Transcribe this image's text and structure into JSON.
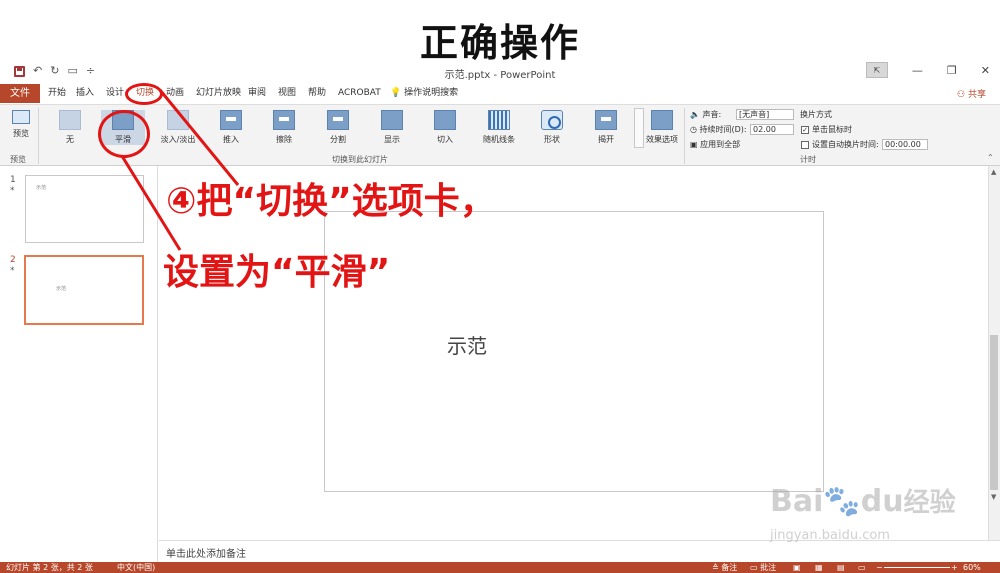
{
  "heading": "正确操作",
  "window": {
    "doc_title": "示范.pptx - PowerPoint",
    "share": "共享",
    "undo_icon": "↶",
    "redo_icon": "↻",
    "qat_more": "÷"
  },
  "tabs": {
    "file": "文件",
    "items": [
      "开始",
      "插入",
      "设计",
      "切换",
      "动画",
      "幻灯片放映",
      "审阅",
      "视图",
      "帮助",
      "ACROBAT",
      "操作说明搜索"
    ]
  },
  "ribbon": {
    "preview_label": "预览",
    "preview_group": "预览",
    "effects": [
      "无",
      "平滑",
      "淡入/淡出",
      "推入",
      "擦除",
      "分割",
      "显示",
      "切入",
      "随机线条",
      "形状",
      "揭开"
    ],
    "effect_options": "效果选项",
    "transition_group": "切换到此幻灯片",
    "sound_label": "声音:",
    "sound_value": "[无声音]",
    "duration_label": "持续时间(D):",
    "duration_value": "02.00",
    "apply_all": "应用到全部",
    "advance_title": "换片方式",
    "on_click": "单击鼠标时",
    "auto_after": "设置自动换片时间:",
    "auto_value": "00:00.00",
    "timing_group": "计时"
  },
  "slides": [
    {
      "num": "1",
      "mark": "*",
      "text": "示范"
    },
    {
      "num": "2",
      "mark": "*",
      "text": "示范"
    }
  ],
  "slide_text": "示范",
  "notes_placeholder": "单击此处添加备注",
  "status": {
    "slide_info": "幻灯片 第 2 张，共 2 张",
    "language": "中文(中国)",
    "notes": "备注",
    "comments": "批注",
    "zoom": "60%"
  },
  "annotations": {
    "line1": "④把“切换”选项卡，",
    "line2": "设置为“平滑”"
  },
  "watermark": {
    "brand": "Bai",
    "brand2": "du",
    "cn": "经验",
    "url": "jingyan.baidu.com"
  },
  "colors": {
    "accent": "#b7472a",
    "annotation": "#e21414"
  }
}
